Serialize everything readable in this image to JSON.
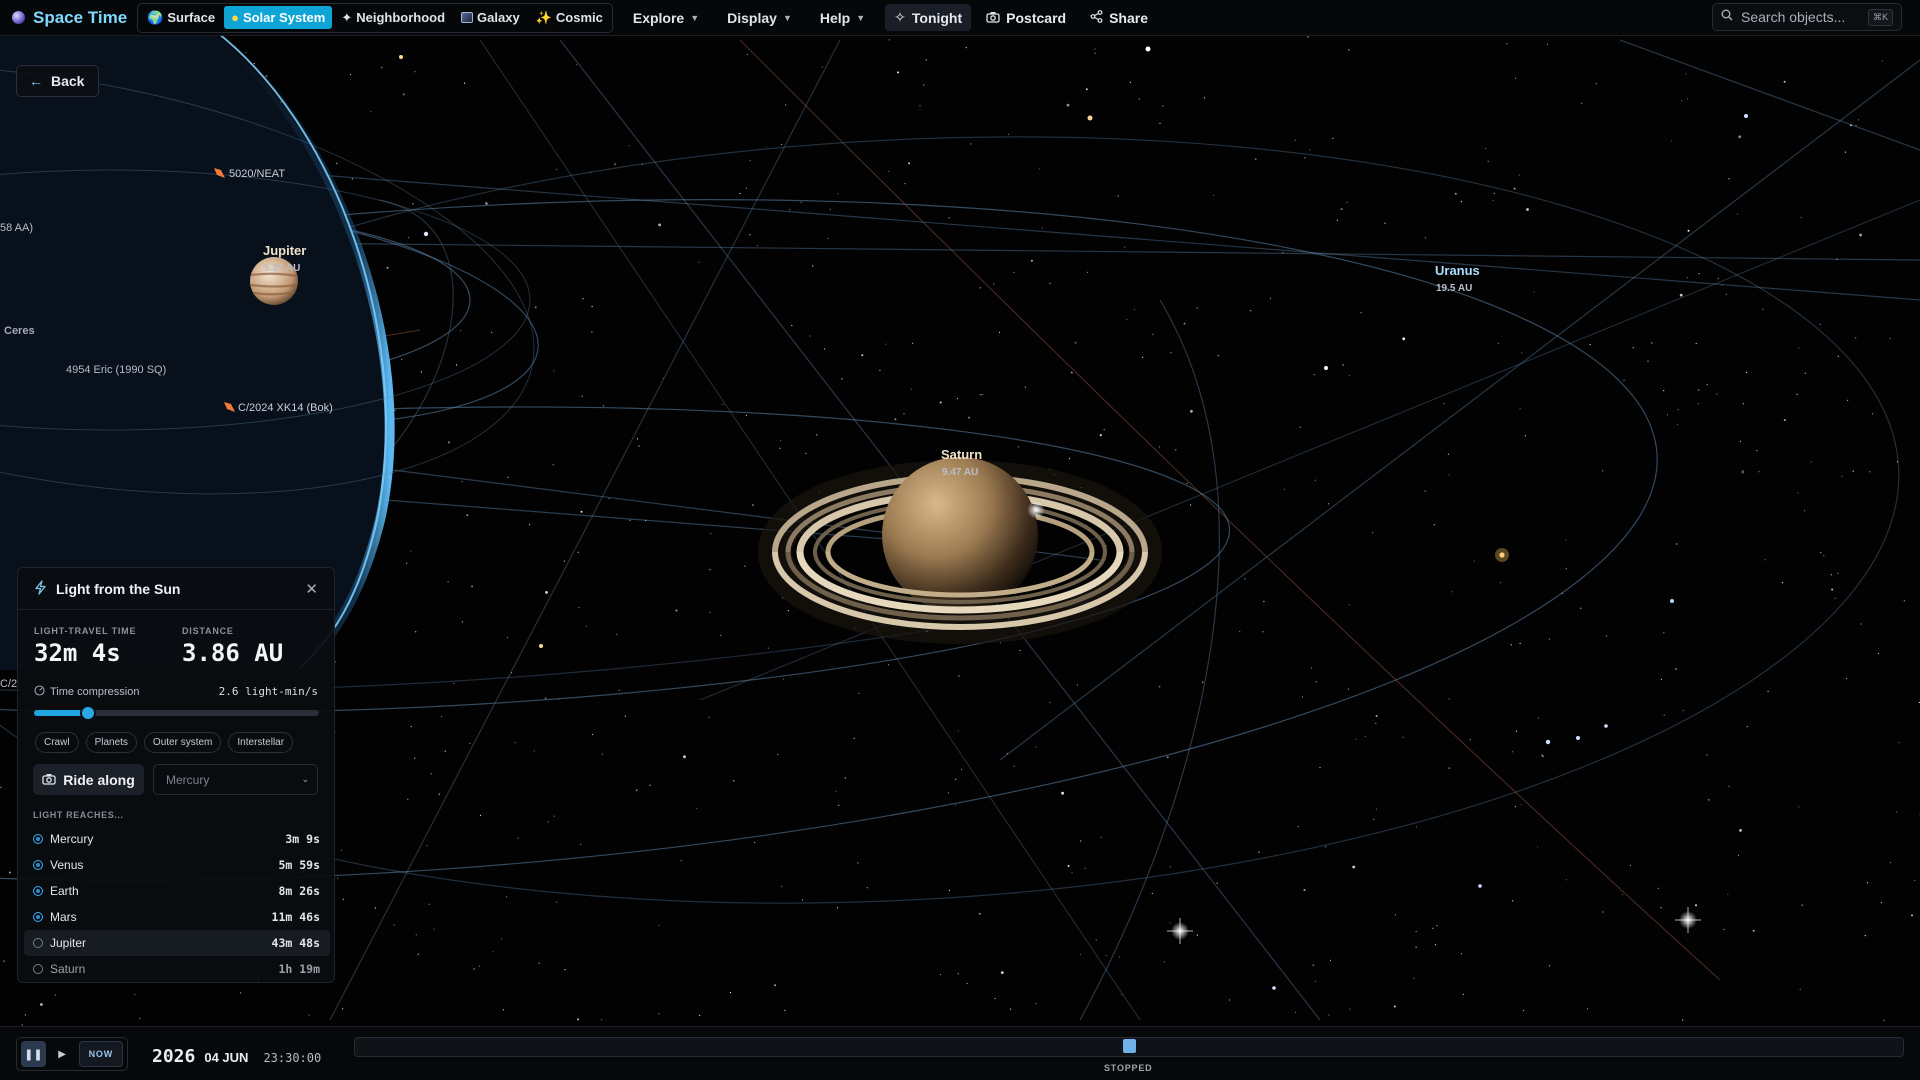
{
  "app": {
    "title": "Space Time"
  },
  "nav": {
    "tabs": [
      {
        "label": "Surface",
        "icon": "earth-icon"
      },
      {
        "label": "Solar System",
        "icon": "sun-icon",
        "active": true
      },
      {
        "label": "Neighborhood",
        "icon": "star-icon"
      },
      {
        "label": "Galaxy",
        "icon": "galaxy-icon"
      },
      {
        "label": "Cosmic",
        "icon": "sparkle-icon"
      }
    ],
    "menus": [
      "Explore",
      "Display",
      "Help"
    ],
    "actions": {
      "tonight": "Tonight",
      "postcard": "Postcard",
      "share": "Share"
    },
    "search": {
      "placeholder": "Search objects...",
      "shortcut": "⌘K"
    }
  },
  "back_label": "Back",
  "scene": {
    "labels": {
      "comet_neat": "5020/NEAT",
      "jupiter": "Jupiter",
      "jupiter_au": "5.37 AU",
      "ceres": "Ceres",
      "eric": "4954 Eric (1990 SQ)",
      "comet_bok": "C/2024 XK14 (Bok)",
      "cut_aa": "58 AA)",
      "cut_c": "C/2",
      "saturn": "Saturn",
      "saturn_au": "9.47 AU",
      "uranus": "Uranus",
      "uranus_au": "19.5 AU"
    }
  },
  "panel": {
    "title": "Light from the Sun",
    "light_travel_label": "LIGHT-TRAVEL TIME",
    "light_travel_value": "32m 4s",
    "distance_label": "DISTANCE",
    "distance_value": "3.86 AU",
    "compression_label": "Time compression",
    "compression_value": "2.6 light-min/s",
    "compression_slider": 0.19,
    "presets": [
      "Crawl",
      "Planets",
      "Outer system",
      "Interstellar"
    ],
    "ride_along_label": "Ride along",
    "ride_target": "Mercury",
    "reaches_title": "LIGHT REACHES...",
    "reaches": [
      {
        "name": "Mercury",
        "time": "3m 9s",
        "reached": true
      },
      {
        "name": "Venus",
        "time": "5m 59s",
        "reached": true
      },
      {
        "name": "Earth",
        "time": "8m 26s",
        "reached": true
      },
      {
        "name": "Mars",
        "time": "11m 46s",
        "reached": true
      },
      {
        "name": "Jupiter",
        "time": "43m 48s",
        "reached": false,
        "highlight": true
      },
      {
        "name": "Saturn",
        "time": "1h 19m",
        "reached": false
      }
    ]
  },
  "timebar": {
    "now_label": "NOW",
    "year": "2026",
    "day": "04 JUN",
    "time": "23:30:00",
    "status": "STOPPED"
  },
  "colors": {
    "accent": "#0ea5d6",
    "brand": "#7fd8ff",
    "orbit": "#5f87aa"
  }
}
